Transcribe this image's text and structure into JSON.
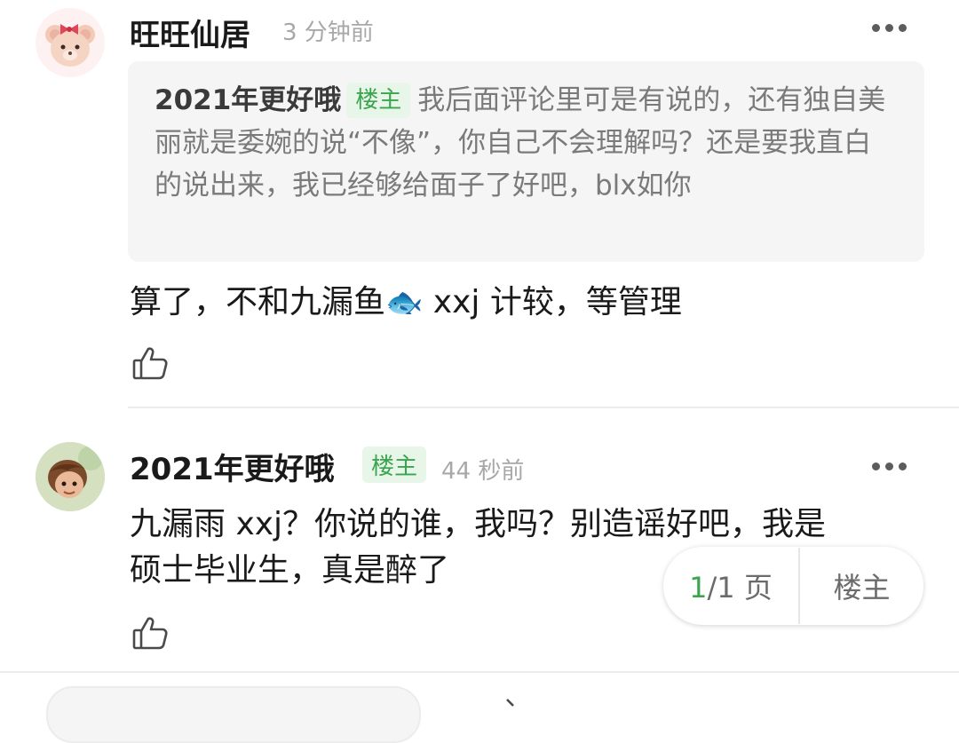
{
  "comments": [
    {
      "username": "旺旺仙居",
      "time": "3 分钟前",
      "quote": {
        "name": "2021年更好哦",
        "badge": "楼主",
        "text": "我后面评论里可是有说的，还有独自美丽就是委婉的说“不像”，你自己不会理解吗？还是要我直白的说出来，我已经够给面子了好吧，blx如你"
      },
      "text_before_emoji": "算了，不和九漏鱼",
      "emoji": "🐟",
      "text_after_emoji": " xxj 计较，等管理"
    },
    {
      "username": "2021年更好哦",
      "badge": "楼主",
      "time": "44 秒前",
      "text_line1": "九漏雨 xxj？你说的谁，我吗？别造谣好吧，我是",
      "text_line2": "硕士毕业生，真是醉了"
    }
  ],
  "pager": {
    "current": "1",
    "total": "/1 页",
    "owner_label": "楼主"
  },
  "colors": {
    "accent": "#3aa54d",
    "badge_bg": "#e8f6ea",
    "muted": "#a8a8a8",
    "quote_bg": "#f5f5f5"
  }
}
